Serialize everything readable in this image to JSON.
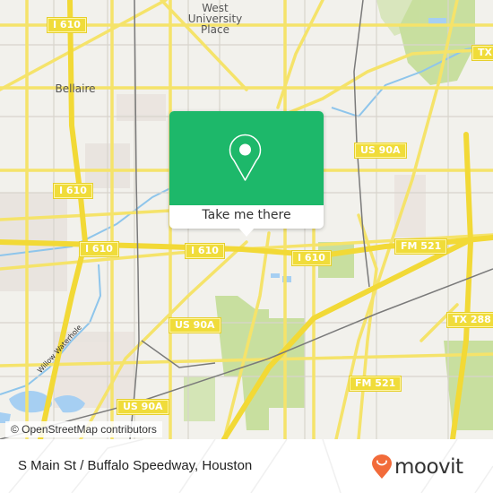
{
  "map": {
    "place_labels": [
      {
        "id": "west-university-place",
        "lines": [
          "West",
          "University",
          "Place"
        ]
      },
      {
        "id": "bellaire",
        "lines": [
          "Bellaire"
        ]
      }
    ],
    "shields": [
      {
        "id": "i610-nw",
        "text": "I 610"
      },
      {
        "id": "i610-w",
        "text": "I 610"
      },
      {
        "id": "i610-center-left",
        "text": "I 610"
      },
      {
        "id": "i610-center-mid",
        "text": "I 610"
      },
      {
        "id": "i610-center-right",
        "text": "I 610"
      },
      {
        "id": "us90a-ne",
        "text": "US 90A"
      },
      {
        "id": "us90a-center",
        "text": "US 90A"
      },
      {
        "id": "us90a-sw",
        "text": "US 90A"
      },
      {
        "id": "fm521-east",
        "text": "FM 521"
      },
      {
        "id": "fm521-south",
        "text": "FM 521"
      },
      {
        "id": "tx288-east",
        "text": "TX 288"
      },
      {
        "id": "tx-ne",
        "text": "TX"
      }
    ],
    "water_label": "Willow Waterhole",
    "attribution": "© OpenStreetMap contributors"
  },
  "popup": {
    "icon": "map-pin-icon",
    "button_label": "Take me there",
    "color": "#1db86a"
  },
  "footer": {
    "address": "S Main St / Buffalo Speedway, Houston",
    "brand": "moovit",
    "brand_color": "#f26b3a"
  }
}
